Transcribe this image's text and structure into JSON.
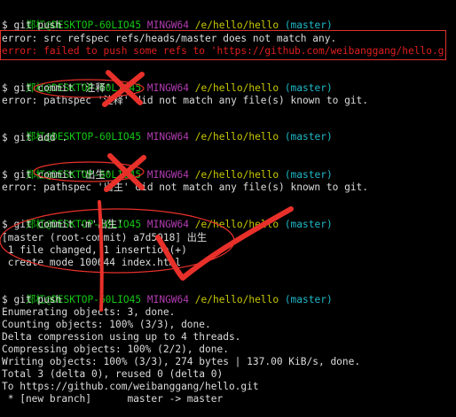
{
  "prompt_sep": " ",
  "blocks": [
    {
      "user": "郑杠@DESKTOP-60LIO45",
      "system": "MINGW64",
      "path": "/e/hello/hello",
      "branch": "(master)"
    },
    {
      "user": "郑杠@DESKTOP-60LIO45",
      "system": "MINGW64",
      "path": "/e/hello/hello",
      "branch": "(master)"
    },
    {
      "user": "郑杠@DESKTOP-60LIO45",
      "system": "MINGW64",
      "path": "/e/hello/hello",
      "branch": "(master)"
    },
    {
      "user": "郑杠@DESKTOP-60LIO45",
      "system": "MINGW64",
      "path": "/e/hello/hello",
      "branch": "(master)"
    },
    {
      "user": "郑杠@DESKTOP-60LIO45",
      "system": "MINGW64",
      "path": "/e/hello/hello",
      "branch": "(master)"
    },
    {
      "user": "郑杠@DESKTOP-60LIO45",
      "system": "MINGW64",
      "path": "/e/hello/hello",
      "branch": "(master)"
    }
  ],
  "lines": {
    "cmd1": "$ git push",
    "err1": "error: src refspec refs/heads/master does not match any.",
    "err2": "error: failed to push some refs to 'https://github.com/weibanggang/hello.g",
    "cmd2": "$ git commit '注释'",
    "err3": "error: pathspec '注释' did not match any file(s) known to git.",
    "cmd3": "$ git add .",
    "cmd4": "$ git commit '出生'",
    "err4": "error: pathspec '出生' did not match any file(s) known to git.",
    "cmd5": "$ git commit -m'出生'",
    "out1": "[master (root-commit) a7d5018] 出生",
    "out2": " 1 file changed, 1 insertion(+)",
    "out3": " create mode 100644 index.html",
    "cmd6": "$ git push",
    "p1": "Enumerating objects: 3, done.",
    "p2": "Counting objects: 100% (3/3), done.",
    "p3": "Delta compression using up to 4 threads.",
    "p4": "Compressing objects: 100% (2/2), done.",
    "p5": "Writing objects: 100% (3/3), 274 bytes | 137.00 KiB/s, done.",
    "p6": "Total 3 (delta 0), reused 0 (delta 0)",
    "p7": "To https://github.com/weibanggang/hello.git",
    "p8": " * [new branch]      master -> master"
  },
  "colors": {
    "prompt_user": "#14c814",
    "prompt_system": "#b13cb1",
    "prompt_path": "#c8c800",
    "prompt_branch": "#1fb8c8",
    "error_highlight": "#e01e1e",
    "annotation": "#e8302a"
  }
}
